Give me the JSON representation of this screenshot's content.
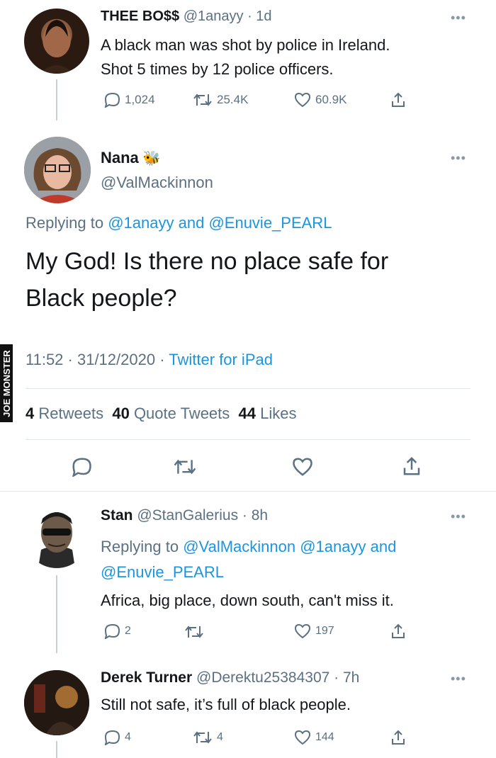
{
  "watermark": "JOE MONSTER",
  "tweet1": {
    "name": "THEE BO$$",
    "handle": "@1anayy",
    "time": "1d",
    "text_line1": "A black man was shot by police in Ireland.",
    "text_line2": "Shot 5 times by 12 police officers.",
    "replies": "1,024",
    "retweets": "25.4K",
    "likes": "60.9K"
  },
  "main": {
    "name": "Nana",
    "name_emoji": "🐝",
    "handle": "@ValMackinnon",
    "replying_prefix": "Replying to",
    "reply_to1": "@1anayy",
    "reply_and": "and",
    "reply_to2": "@Enuvie_PEARL",
    "text_line1": "My God!  Is there no place safe for",
    "text_line2": "Black people?",
    "timestamp": "11:52 · 31/12/2020 ·",
    "source": "Twitter for iPad",
    "retweets_count": "4",
    "retweets_label": "Retweets",
    "quotes_count": "40",
    "quotes_label": "Quote Tweets",
    "likes_count": "44",
    "likes_label": "Likes"
  },
  "reply1": {
    "name": "Stan",
    "handle": "@StanGalerius",
    "time": "8h",
    "replying_prefix": "Replying to",
    "reply_to1": "@ValMackinnon",
    "reply_to2": "@1anayy",
    "reply_and": "and",
    "reply_to3": "@Enuvie_PEARL",
    "text": "Africa, big place, down south, can't miss it.",
    "replies": "2",
    "likes": "197"
  },
  "reply2": {
    "name": "Derek Turner",
    "handle": "@Derektu25384307",
    "time": "7h",
    "text": "Still not safe, it’s full of black people.",
    "replies": "4",
    "retweets": "4",
    "likes": "144"
  },
  "colors": {
    "link": "#1b95e0",
    "muted": "#5b7083",
    "divider": "#e1e8ed"
  }
}
